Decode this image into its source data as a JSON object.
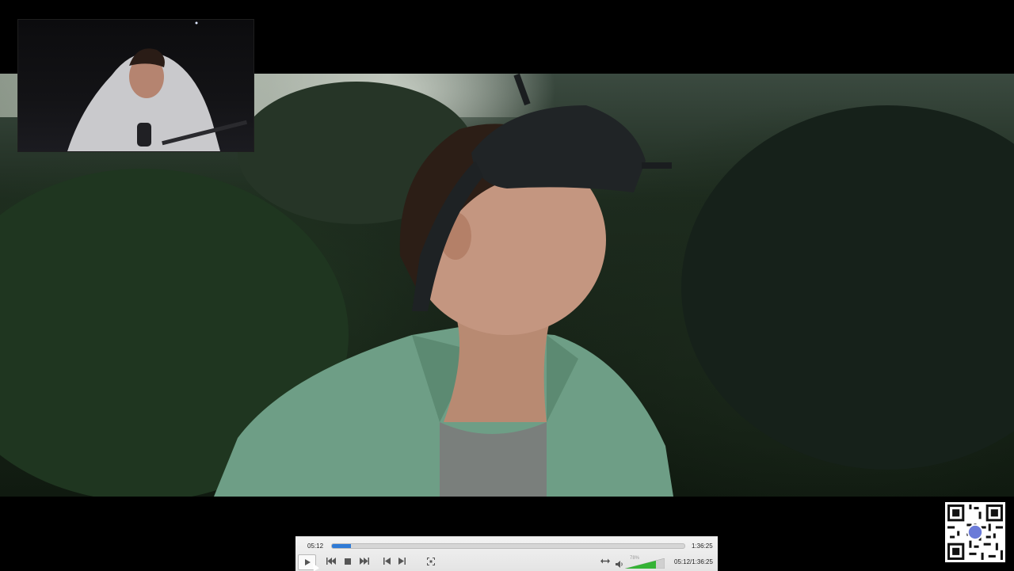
{
  "player": {
    "elapsed": "05:12",
    "duration": "1:36:25",
    "position_readout": "05:12/1:36:25",
    "progress_fraction": 0.054,
    "volume_label": "78%",
    "volume_fraction": 0.78,
    "accent_color": "#2f7bd6",
    "volume_color": "#35b335"
  },
  "controls": {
    "play_icon": "play-icon",
    "stop_icon": "stop-icon",
    "previous_icon": "previous-icon",
    "next_icon": "next-icon",
    "skip_back_icon": "skip-back-icon",
    "skip_forward_icon": "skip-forward-icon",
    "fullscreen_icon": "fullscreen-icon",
    "stretch_icon": "stretch-icon",
    "speaker_icon": "speaker-icon"
  }
}
